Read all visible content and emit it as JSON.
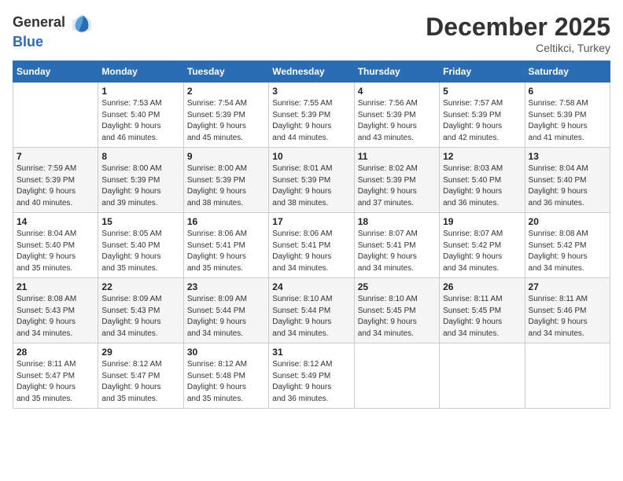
{
  "header": {
    "logo_general": "General",
    "logo_blue": "Blue",
    "month_title": "December 2025",
    "location": "Celtikci, Turkey"
  },
  "days_of_week": [
    "Sunday",
    "Monday",
    "Tuesday",
    "Wednesday",
    "Thursday",
    "Friday",
    "Saturday"
  ],
  "weeks": [
    {
      "shaded": false,
      "days": [
        {
          "num": "",
          "detail": ""
        },
        {
          "num": "1",
          "detail": "Sunrise: 7:53 AM\nSunset: 5:40 PM\nDaylight: 9 hours\nand 46 minutes."
        },
        {
          "num": "2",
          "detail": "Sunrise: 7:54 AM\nSunset: 5:39 PM\nDaylight: 9 hours\nand 45 minutes."
        },
        {
          "num": "3",
          "detail": "Sunrise: 7:55 AM\nSunset: 5:39 PM\nDaylight: 9 hours\nand 44 minutes."
        },
        {
          "num": "4",
          "detail": "Sunrise: 7:56 AM\nSunset: 5:39 PM\nDaylight: 9 hours\nand 43 minutes."
        },
        {
          "num": "5",
          "detail": "Sunrise: 7:57 AM\nSunset: 5:39 PM\nDaylight: 9 hours\nand 42 minutes."
        },
        {
          "num": "6",
          "detail": "Sunrise: 7:58 AM\nSunset: 5:39 PM\nDaylight: 9 hours\nand 41 minutes."
        }
      ]
    },
    {
      "shaded": true,
      "days": [
        {
          "num": "7",
          "detail": "Sunrise: 7:59 AM\nSunset: 5:39 PM\nDaylight: 9 hours\nand 40 minutes."
        },
        {
          "num": "8",
          "detail": "Sunrise: 8:00 AM\nSunset: 5:39 PM\nDaylight: 9 hours\nand 39 minutes."
        },
        {
          "num": "9",
          "detail": "Sunrise: 8:00 AM\nSunset: 5:39 PM\nDaylight: 9 hours\nand 38 minutes."
        },
        {
          "num": "10",
          "detail": "Sunrise: 8:01 AM\nSunset: 5:39 PM\nDaylight: 9 hours\nand 38 minutes."
        },
        {
          "num": "11",
          "detail": "Sunrise: 8:02 AM\nSunset: 5:39 PM\nDaylight: 9 hours\nand 37 minutes."
        },
        {
          "num": "12",
          "detail": "Sunrise: 8:03 AM\nSunset: 5:40 PM\nDaylight: 9 hours\nand 36 minutes."
        },
        {
          "num": "13",
          "detail": "Sunrise: 8:04 AM\nSunset: 5:40 PM\nDaylight: 9 hours\nand 36 minutes."
        }
      ]
    },
    {
      "shaded": false,
      "days": [
        {
          "num": "14",
          "detail": "Sunrise: 8:04 AM\nSunset: 5:40 PM\nDaylight: 9 hours\nand 35 minutes."
        },
        {
          "num": "15",
          "detail": "Sunrise: 8:05 AM\nSunset: 5:40 PM\nDaylight: 9 hours\nand 35 minutes."
        },
        {
          "num": "16",
          "detail": "Sunrise: 8:06 AM\nSunset: 5:41 PM\nDaylight: 9 hours\nand 35 minutes."
        },
        {
          "num": "17",
          "detail": "Sunrise: 8:06 AM\nSunset: 5:41 PM\nDaylight: 9 hours\nand 34 minutes."
        },
        {
          "num": "18",
          "detail": "Sunrise: 8:07 AM\nSunset: 5:41 PM\nDaylight: 9 hours\nand 34 minutes."
        },
        {
          "num": "19",
          "detail": "Sunrise: 8:07 AM\nSunset: 5:42 PM\nDaylight: 9 hours\nand 34 minutes."
        },
        {
          "num": "20",
          "detail": "Sunrise: 8:08 AM\nSunset: 5:42 PM\nDaylight: 9 hours\nand 34 minutes."
        }
      ]
    },
    {
      "shaded": true,
      "days": [
        {
          "num": "21",
          "detail": "Sunrise: 8:08 AM\nSunset: 5:43 PM\nDaylight: 9 hours\nand 34 minutes."
        },
        {
          "num": "22",
          "detail": "Sunrise: 8:09 AM\nSunset: 5:43 PM\nDaylight: 9 hours\nand 34 minutes."
        },
        {
          "num": "23",
          "detail": "Sunrise: 8:09 AM\nSunset: 5:44 PM\nDaylight: 9 hours\nand 34 minutes."
        },
        {
          "num": "24",
          "detail": "Sunrise: 8:10 AM\nSunset: 5:44 PM\nDaylight: 9 hours\nand 34 minutes."
        },
        {
          "num": "25",
          "detail": "Sunrise: 8:10 AM\nSunset: 5:45 PM\nDaylight: 9 hours\nand 34 minutes."
        },
        {
          "num": "26",
          "detail": "Sunrise: 8:11 AM\nSunset: 5:45 PM\nDaylight: 9 hours\nand 34 minutes."
        },
        {
          "num": "27",
          "detail": "Sunrise: 8:11 AM\nSunset: 5:46 PM\nDaylight: 9 hours\nand 34 minutes."
        }
      ]
    },
    {
      "shaded": false,
      "days": [
        {
          "num": "28",
          "detail": "Sunrise: 8:11 AM\nSunset: 5:47 PM\nDaylight: 9 hours\nand 35 minutes."
        },
        {
          "num": "29",
          "detail": "Sunrise: 8:12 AM\nSunset: 5:47 PM\nDaylight: 9 hours\nand 35 minutes."
        },
        {
          "num": "30",
          "detail": "Sunrise: 8:12 AM\nSunset: 5:48 PM\nDaylight: 9 hours\nand 35 minutes."
        },
        {
          "num": "31",
          "detail": "Sunrise: 8:12 AM\nSunset: 5:49 PM\nDaylight: 9 hours\nand 36 minutes."
        },
        {
          "num": "",
          "detail": ""
        },
        {
          "num": "",
          "detail": ""
        },
        {
          "num": "",
          "detail": ""
        }
      ]
    }
  ]
}
